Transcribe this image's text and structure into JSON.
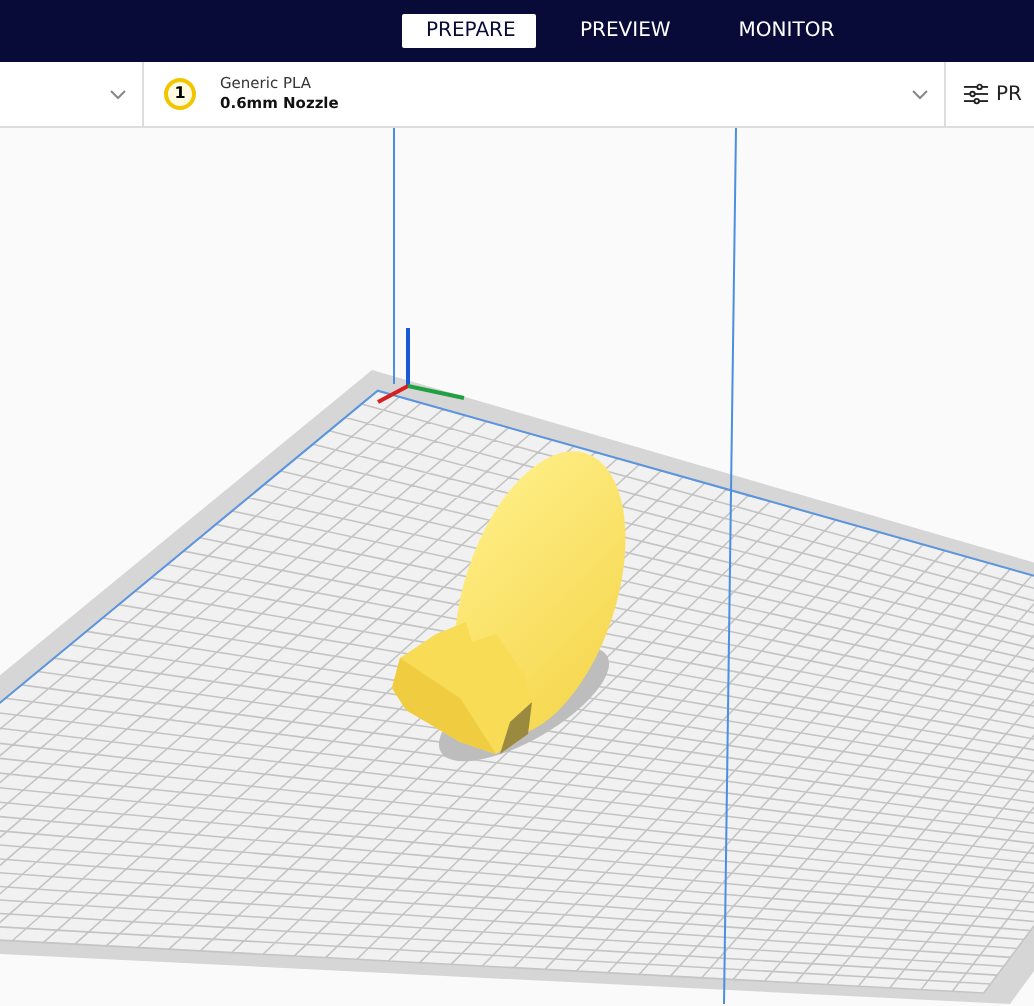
{
  "tabs": [
    {
      "label": "PREPARE",
      "selected": true
    },
    {
      "label": "PREVIEW",
      "selected": false
    },
    {
      "label": "MONITOR",
      "selected": false
    }
  ],
  "extruder": {
    "number": "1",
    "material": "Generic PLA",
    "nozzle": "0.6mm Nozzle"
  },
  "settings": {
    "label": "PR"
  }
}
